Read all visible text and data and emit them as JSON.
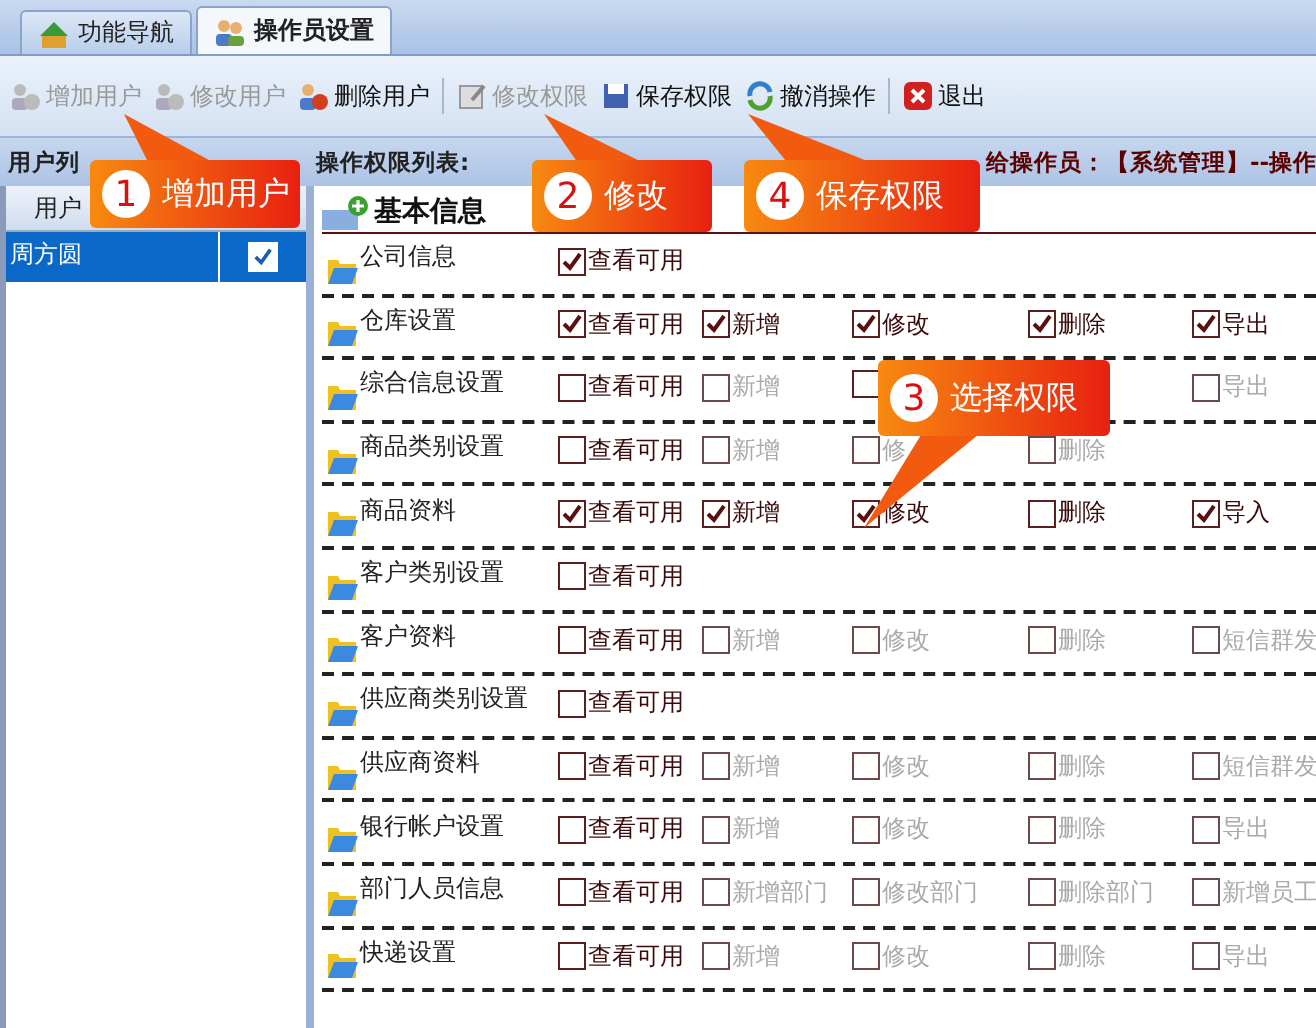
{
  "tabs": [
    {
      "label": "功能导航",
      "selected": false
    },
    {
      "label": "操作员设置",
      "selected": true
    }
  ],
  "toolbar": [
    [
      {
        "label": "增加用户",
        "disabled": true
      },
      {
        "label": "修改用户",
        "disabled": true
      },
      {
        "label": "删除用户",
        "disabled": false
      }
    ],
    [
      {
        "label": "修改权限",
        "disabled": true
      },
      {
        "label": "保存权限",
        "disabled": false
      },
      {
        "label": "撤消操作",
        "disabled": false
      }
    ],
    [
      {
        "label": "退出",
        "disabled": false
      }
    ]
  ],
  "header": {
    "users_title": "用户列",
    "permissions_title": "操作权限列表:",
    "operator": "给操作员：【系统管理】--操作"
  },
  "users": {
    "column": "用户",
    "rows": [
      {
        "name": "周方圆",
        "checked": true,
        "selected": true
      }
    ]
  },
  "section": {
    "title": "基本信息"
  },
  "rows": [
    {
      "name": "公司信息",
      "items": [
        {
          "label": "查看可用",
          "checked": true,
          "disabled": false
        }
      ]
    },
    {
      "name": "仓库设置",
      "items": [
        {
          "label": "查看可用",
          "checked": true,
          "disabled": false
        },
        {
          "label": "新增",
          "checked": true,
          "disabled": false
        },
        {
          "label": "修改",
          "checked": true,
          "disabled": false
        },
        {
          "label": "删除",
          "checked": true,
          "disabled": false
        },
        {
          "label": "导出",
          "checked": true,
          "disabled": false
        }
      ]
    },
    {
      "name": "综合信息设置",
      "items": [
        {
          "label": "查看可用",
          "checked": false,
          "disabled": false
        },
        {
          "label": "新增",
          "checked": false,
          "disabled": true
        },
        {
          "checked": false
        },
        {
          "label": "导出",
          "checked": false,
          "disabled": true
        }
      ]
    },
    {
      "name": "商品类别设置",
      "items": [
        {
          "label": "查看可用",
          "checked": false,
          "disabled": false
        },
        {
          "label": "新增",
          "checked": false,
          "disabled": true
        },
        {
          "label": "修",
          "checked": false,
          "disabled": true
        },
        {
          "label": "删除",
          "checked": false,
          "disabled": true
        }
      ]
    },
    {
      "name": "商品资料",
      "items": [
        {
          "label": "查看可用",
          "checked": true,
          "disabled": false
        },
        {
          "label": "新增",
          "checked": true,
          "disabled": false
        },
        {
          "label": "修改",
          "checked": true,
          "disabled": false
        },
        {
          "label": "删除",
          "checked": false,
          "disabled": false
        },
        {
          "label": "导入",
          "checked": true,
          "disabled": false
        }
      ]
    },
    {
      "name": "客户类别设置",
      "items": [
        {
          "label": "查看可用",
          "checked": false,
          "disabled": false
        }
      ]
    },
    {
      "name": "客户资料",
      "items": [
        {
          "label": "查看可用",
          "checked": false,
          "disabled": false
        },
        {
          "label": "新增",
          "checked": false,
          "disabled": true
        },
        {
          "label": "修改",
          "checked": false,
          "disabled": true
        },
        {
          "label": "删除",
          "checked": false,
          "disabled": true
        },
        {
          "label": "短信群发",
          "checked": false,
          "disabled": true
        }
      ]
    },
    {
      "name": "供应商类别设置",
      "items": [
        {
          "label": "查看可用",
          "checked": false,
          "disabled": false
        }
      ]
    },
    {
      "name": "供应商资料",
      "items": [
        {
          "label": "查看可用",
          "checked": false,
          "disabled": false
        },
        {
          "label": "新增",
          "checked": false,
          "disabled": true
        },
        {
          "label": "修改",
          "checked": false,
          "disabled": true
        },
        {
          "label": "删除",
          "checked": false,
          "disabled": true
        },
        {
          "label": "短信群发",
          "checked": false,
          "disabled": true
        }
      ]
    },
    {
      "name": "银行帐户设置",
      "items": [
        {
          "label": "查看可用",
          "checked": false,
          "disabled": false
        },
        {
          "label": "新增",
          "checked": false,
          "disabled": true
        },
        {
          "label": "修改",
          "checked": false,
          "disabled": true
        },
        {
          "label": "删除",
          "checked": false,
          "disabled": true
        },
        {
          "label": "导出",
          "checked": false,
          "disabled": true
        }
      ]
    },
    {
      "name": "部门人员信息",
      "items": [
        {
          "label": "查看可用",
          "checked": false,
          "disabled": false
        },
        {
          "label": "新增部门",
          "checked": false,
          "disabled": true
        },
        {
          "label": "修改部门",
          "checked": false,
          "disabled": true
        },
        {
          "label": "删除部门",
          "checked": false,
          "disabled": true
        },
        {
          "label": "新增员工",
          "checked": false,
          "disabled": true
        }
      ]
    },
    {
      "name": "快递设置",
      "items": [
        {
          "label": "查看可用",
          "checked": false,
          "disabled": false
        },
        {
          "label": "新增",
          "checked": false,
          "disabled": true
        },
        {
          "label": "修改",
          "checked": false,
          "disabled": true
        },
        {
          "label": "删除",
          "checked": false,
          "disabled": true
        },
        {
          "label": "导出",
          "checked": false,
          "disabled": true
        }
      ]
    }
  ],
  "callouts": [
    {
      "number": "1",
      "label": "增加用户"
    },
    {
      "number": "2",
      "label": "修改"
    },
    {
      "number": "4",
      "label": "保存权限"
    },
    {
      "number": "3",
      "label": "选择权限"
    }
  ]
}
